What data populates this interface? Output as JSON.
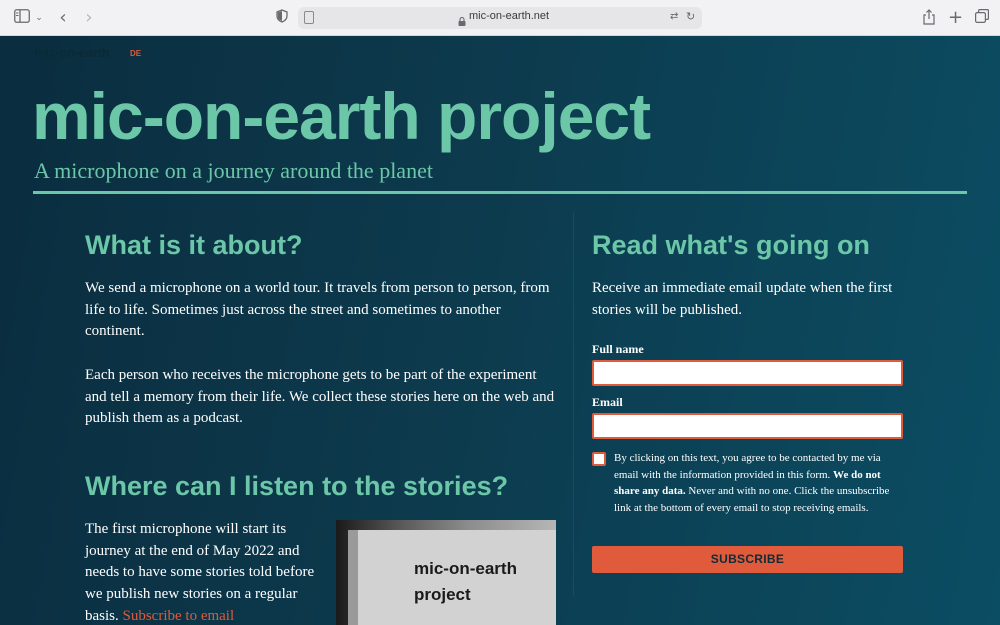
{
  "browser": {
    "url": "mic-on-earth.net",
    "icons": [
      "sidebar-icon",
      "chevron-down-icon",
      "back-icon",
      "forward-icon",
      "shield-icon",
      "page-icon",
      "lock-icon",
      "translate-icon",
      "reload-icon",
      "share-icon",
      "new-tab-icon",
      "tabs-overview-icon"
    ]
  },
  "header": {
    "brand": "mic-on-earth",
    "language": "DE",
    "title": "mic-on-earth project",
    "tagline": "A microphone on a journey around the planet"
  },
  "about": {
    "title": "What is it about?",
    "p1": "We send a microphone on a world tour. It travels from person to person, from life to life. Sometimes just across the street and sometimes to another continent.",
    "p2": "Each person who receives the microphone gets to be part of the experiment and tell a memory from their life. We collect these stories here on the web and publish them as a podcast."
  },
  "listen": {
    "title": "Where can I listen to the stories?",
    "p": "The first microphone will start its journey at the end of May 2022 and needs to have some stories told before we publish new stories on a regular basis.",
    "link": "Subscribe to email",
    "photo_text_1": "mic-on-earth",
    "photo_text_2": "project"
  },
  "signup": {
    "title": "Read what's going on",
    "intro": "Receive an immediate email update when the first stories will be published.",
    "name_label": "Full name",
    "name_value": "",
    "email_label": "Email",
    "email_value": "",
    "consent_1": "By clicking on this text, you agree to be contacted by me via email with the information provided in this form. ",
    "consent_bold": "We do not share any data.",
    "consent_2": " Never and with no one. Click the unsubscribe link at the bottom of every email to stop receiving emails.",
    "button": "SUBSCRIBE"
  },
  "colors": {
    "accent": "#6cc7a8",
    "cta": "#e05a3c",
    "background": "#0d3a4c"
  }
}
